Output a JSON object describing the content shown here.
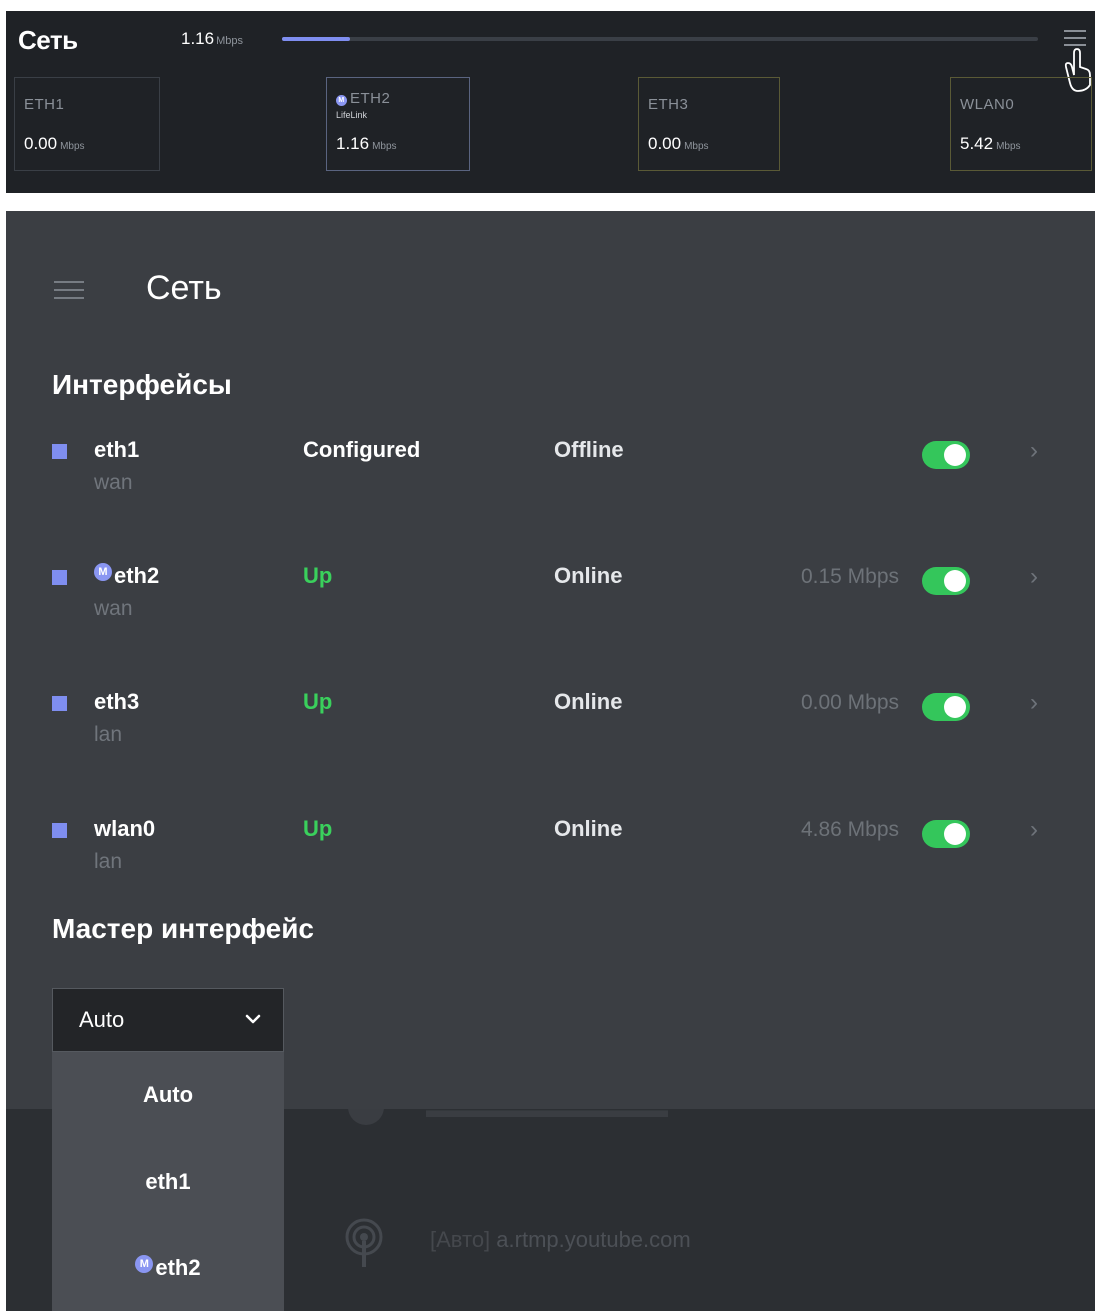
{
  "topbar": {
    "title": "Сеть",
    "rate_value": "1.16",
    "rate_unit": "Mbps",
    "progress": 0.09,
    "accent_color": "#7f8ef0",
    "cards": [
      {
        "name": "ETH1",
        "sub": "",
        "value": "0.00",
        "unit": "Mbps",
        "border": "#3a3f46",
        "master": false
      },
      {
        "name": "ETH2",
        "sub": "LifeLink",
        "value": "1.16",
        "unit": "Mbps",
        "border": "#5a6480",
        "master": true,
        "badge": "M"
      },
      {
        "name": "ETH3",
        "sub": "",
        "value": "0.00",
        "unit": "Mbps",
        "border": "#5a5a36",
        "master": false
      },
      {
        "name": "WLAN0",
        "sub": "",
        "value": "5.42",
        "unit": "Mbps",
        "border": "#5a5a36",
        "master": false
      }
    ]
  },
  "header": {
    "title": "Сеть",
    "menu_icon": "hamburger-icon"
  },
  "interfaces": {
    "title": "Интерфейсы",
    "rows": [
      {
        "name": "eth1",
        "zone": "wan",
        "status": "Configured",
        "status_color": "#ffffff",
        "connection": "Offline",
        "speed": "",
        "enabled": true,
        "master": false
      },
      {
        "name": "eth2",
        "zone": "wan",
        "status": "Up",
        "status_color": "#3ad05c",
        "connection": "Online",
        "speed": "0.15 Mbps",
        "enabled": true,
        "master": true,
        "badge": "M"
      },
      {
        "name": "eth3",
        "zone": "lan",
        "status": "Up",
        "status_color": "#3ad05c",
        "connection": "Online",
        "speed": "0.00 Mbps",
        "enabled": true,
        "master": false
      },
      {
        "name": "wlan0",
        "zone": "lan",
        "status": "Up",
        "status_color": "#3ad05c",
        "connection": "Online",
        "speed": "4.86 Mbps",
        "enabled": true,
        "master": false
      }
    ]
  },
  "master_interface": {
    "title": "Мастер интерфейс",
    "selected": "Auto",
    "options": [
      {
        "label": "Auto",
        "master": false
      },
      {
        "label": "eth1",
        "master": false
      },
      {
        "label": "eth2",
        "master": true,
        "badge": "M"
      }
    ]
  },
  "background": {
    "rtmp_prefix": "[Авто]",
    "rtmp_url": "a.rtmp.youtube.com"
  }
}
